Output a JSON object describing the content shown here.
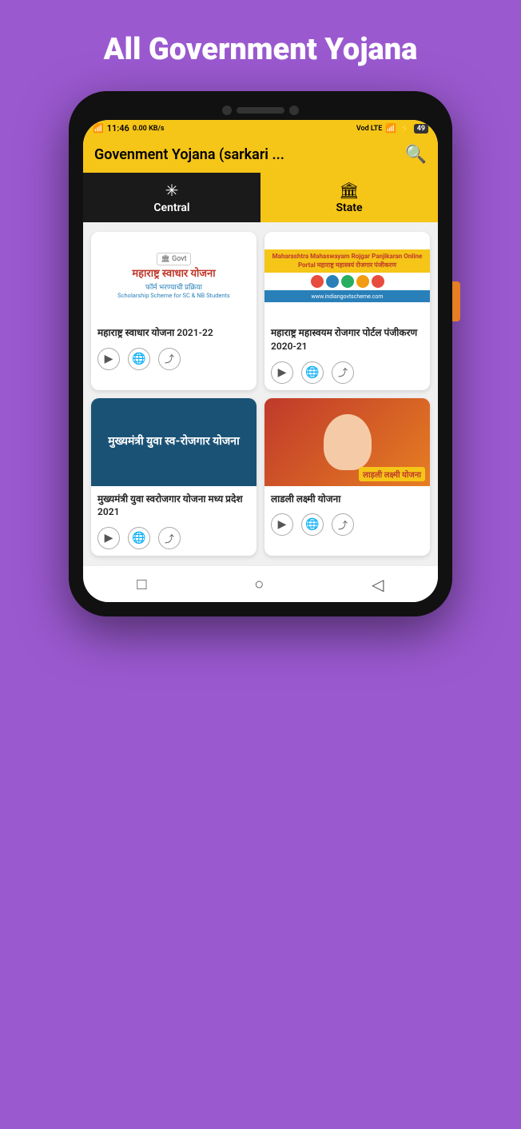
{
  "page": {
    "title": "All Government Yojana",
    "bg_color": "#9b59d0"
  },
  "status_bar": {
    "signal": "4G",
    "time": "11:46",
    "data_speed": "0.00 KB/s",
    "lte": "Vod LTE",
    "wifi": "WiFi",
    "battery": "49"
  },
  "top_bar": {
    "title": "Govenment Yojana (sarkari ...",
    "search_icon": "🔍"
  },
  "tabs": [
    {
      "id": "central",
      "label": "Central",
      "icon": "✳",
      "active": false,
      "bg": "dark"
    },
    {
      "id": "state",
      "label": "State",
      "icon": "🏛",
      "active": true,
      "bg": "yellow"
    }
  ],
  "cards": [
    {
      "id": "card1",
      "title": "महाराष्ट्र स्वाधार योजना 2021-22",
      "image_type": "card-img-1",
      "hindi_title": "महाराष्ट्र स्वाधार योजना",
      "hindi_subtitle": "फॉर्म भरण्याची प्रक्रिया",
      "scholarship_text": "Scholarship Scheme for SC & NB Students"
    },
    {
      "id": "card2",
      "title": "महाराष्ट्र महास्वयम रोजगार पोर्टल पंजीकरण 2020-21",
      "image_type": "card-img-2",
      "top_text": "Maharashtra Mahaswayam Rojgar Panjikaran Online Portal महाराष्ट्र महास्वयं रोजगार पंजीकरण",
      "bottom_text": "www.indiangovtscheme.com"
    },
    {
      "id": "card3",
      "title": "मुख्यमंत्री युवा स्वरोजगार योजना मध्य प्रदेश 2021",
      "image_type": "card-img-3",
      "mukhya_title": "मुख्यमंत्री युवा स्व-रोजगार योजना"
    },
    {
      "id": "card4",
      "title": "लाडली लक्ष्मी योजना",
      "image_type": "card-img-4",
      "laadli_label": "लाड़ली लक्ष्मी योजना"
    }
  ],
  "action_buttons": {
    "play": "▶",
    "globe": "🌐",
    "share": "⬆"
  },
  "bottom_nav": {
    "square": "□",
    "circle": "○",
    "triangle": "◁"
  }
}
